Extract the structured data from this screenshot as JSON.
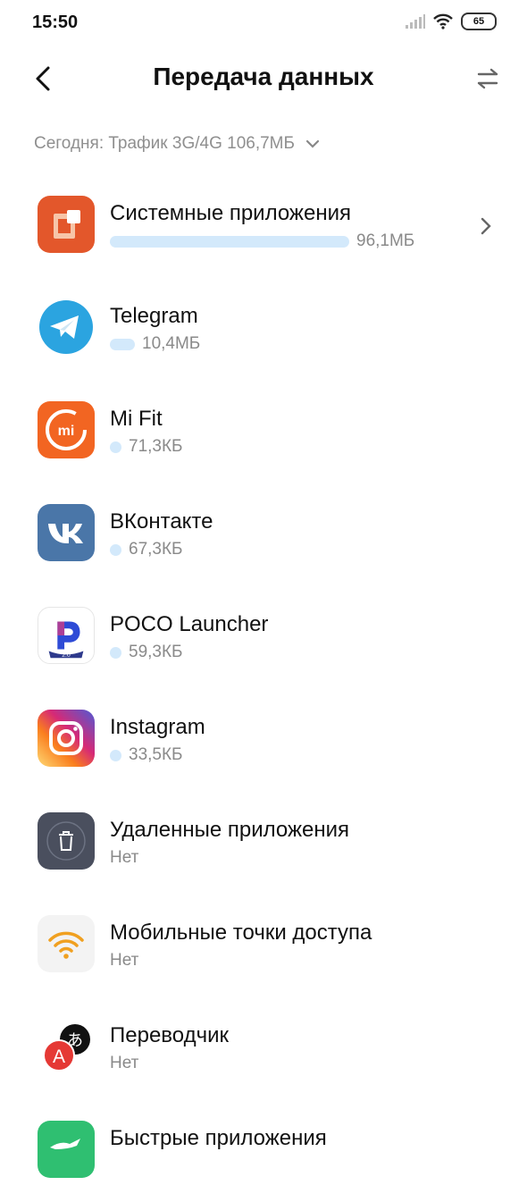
{
  "status_bar": {
    "time": "15:50",
    "battery": "65"
  },
  "header": {
    "title": "Передача данных"
  },
  "filter": {
    "label": "Сегодня: Трафик 3G/4G 106,7МБ"
  },
  "apps": [
    {
      "name": "Системные приложения",
      "usage": "96,1МБ",
      "share": 1.0,
      "icon": "system-apps-icon",
      "color": "#e3572b"
    },
    {
      "name": "Telegram",
      "usage": "10,4МБ",
      "share": 0.11,
      "icon": "telegram-icon",
      "color": "#2ba4e0"
    },
    {
      "name": "Mi Fit",
      "usage": "71,3КБ",
      "share": 0.001,
      "icon": "mi-fit-icon",
      "color": "#f26522"
    },
    {
      "name": "ВКонтакте",
      "usage": "67,3КБ",
      "share": 0.001,
      "icon": "vk-icon",
      "color": "#4a76a8"
    },
    {
      "name": "POCO Launcher",
      "usage": "59,3КБ",
      "share": 0.001,
      "icon": "poco-launcher-icon",
      "color": "#2e4bd6"
    },
    {
      "name": "Instagram",
      "usage": "33,5КБ",
      "share": 0.0005,
      "icon": "instagram-icon",
      "color": "#c13584"
    },
    {
      "name": "Удаленные приложения",
      "usage": "Нет",
      "share": 0,
      "icon": "trash-icon",
      "color": "#4a4f5e"
    },
    {
      "name": "Мобильные точки доступа",
      "usage": "Нет",
      "share": 0,
      "icon": "hotspot-icon",
      "color": "#f0a020"
    },
    {
      "name": "Переводчик",
      "usage": "Нет",
      "share": 0,
      "icon": "translator-icon",
      "color": "#e53935"
    },
    {
      "name": "Быстрые приложения",
      "usage": "",
      "share": 0,
      "icon": "quick-apps-icon",
      "color": "#2fbf71"
    }
  ]
}
